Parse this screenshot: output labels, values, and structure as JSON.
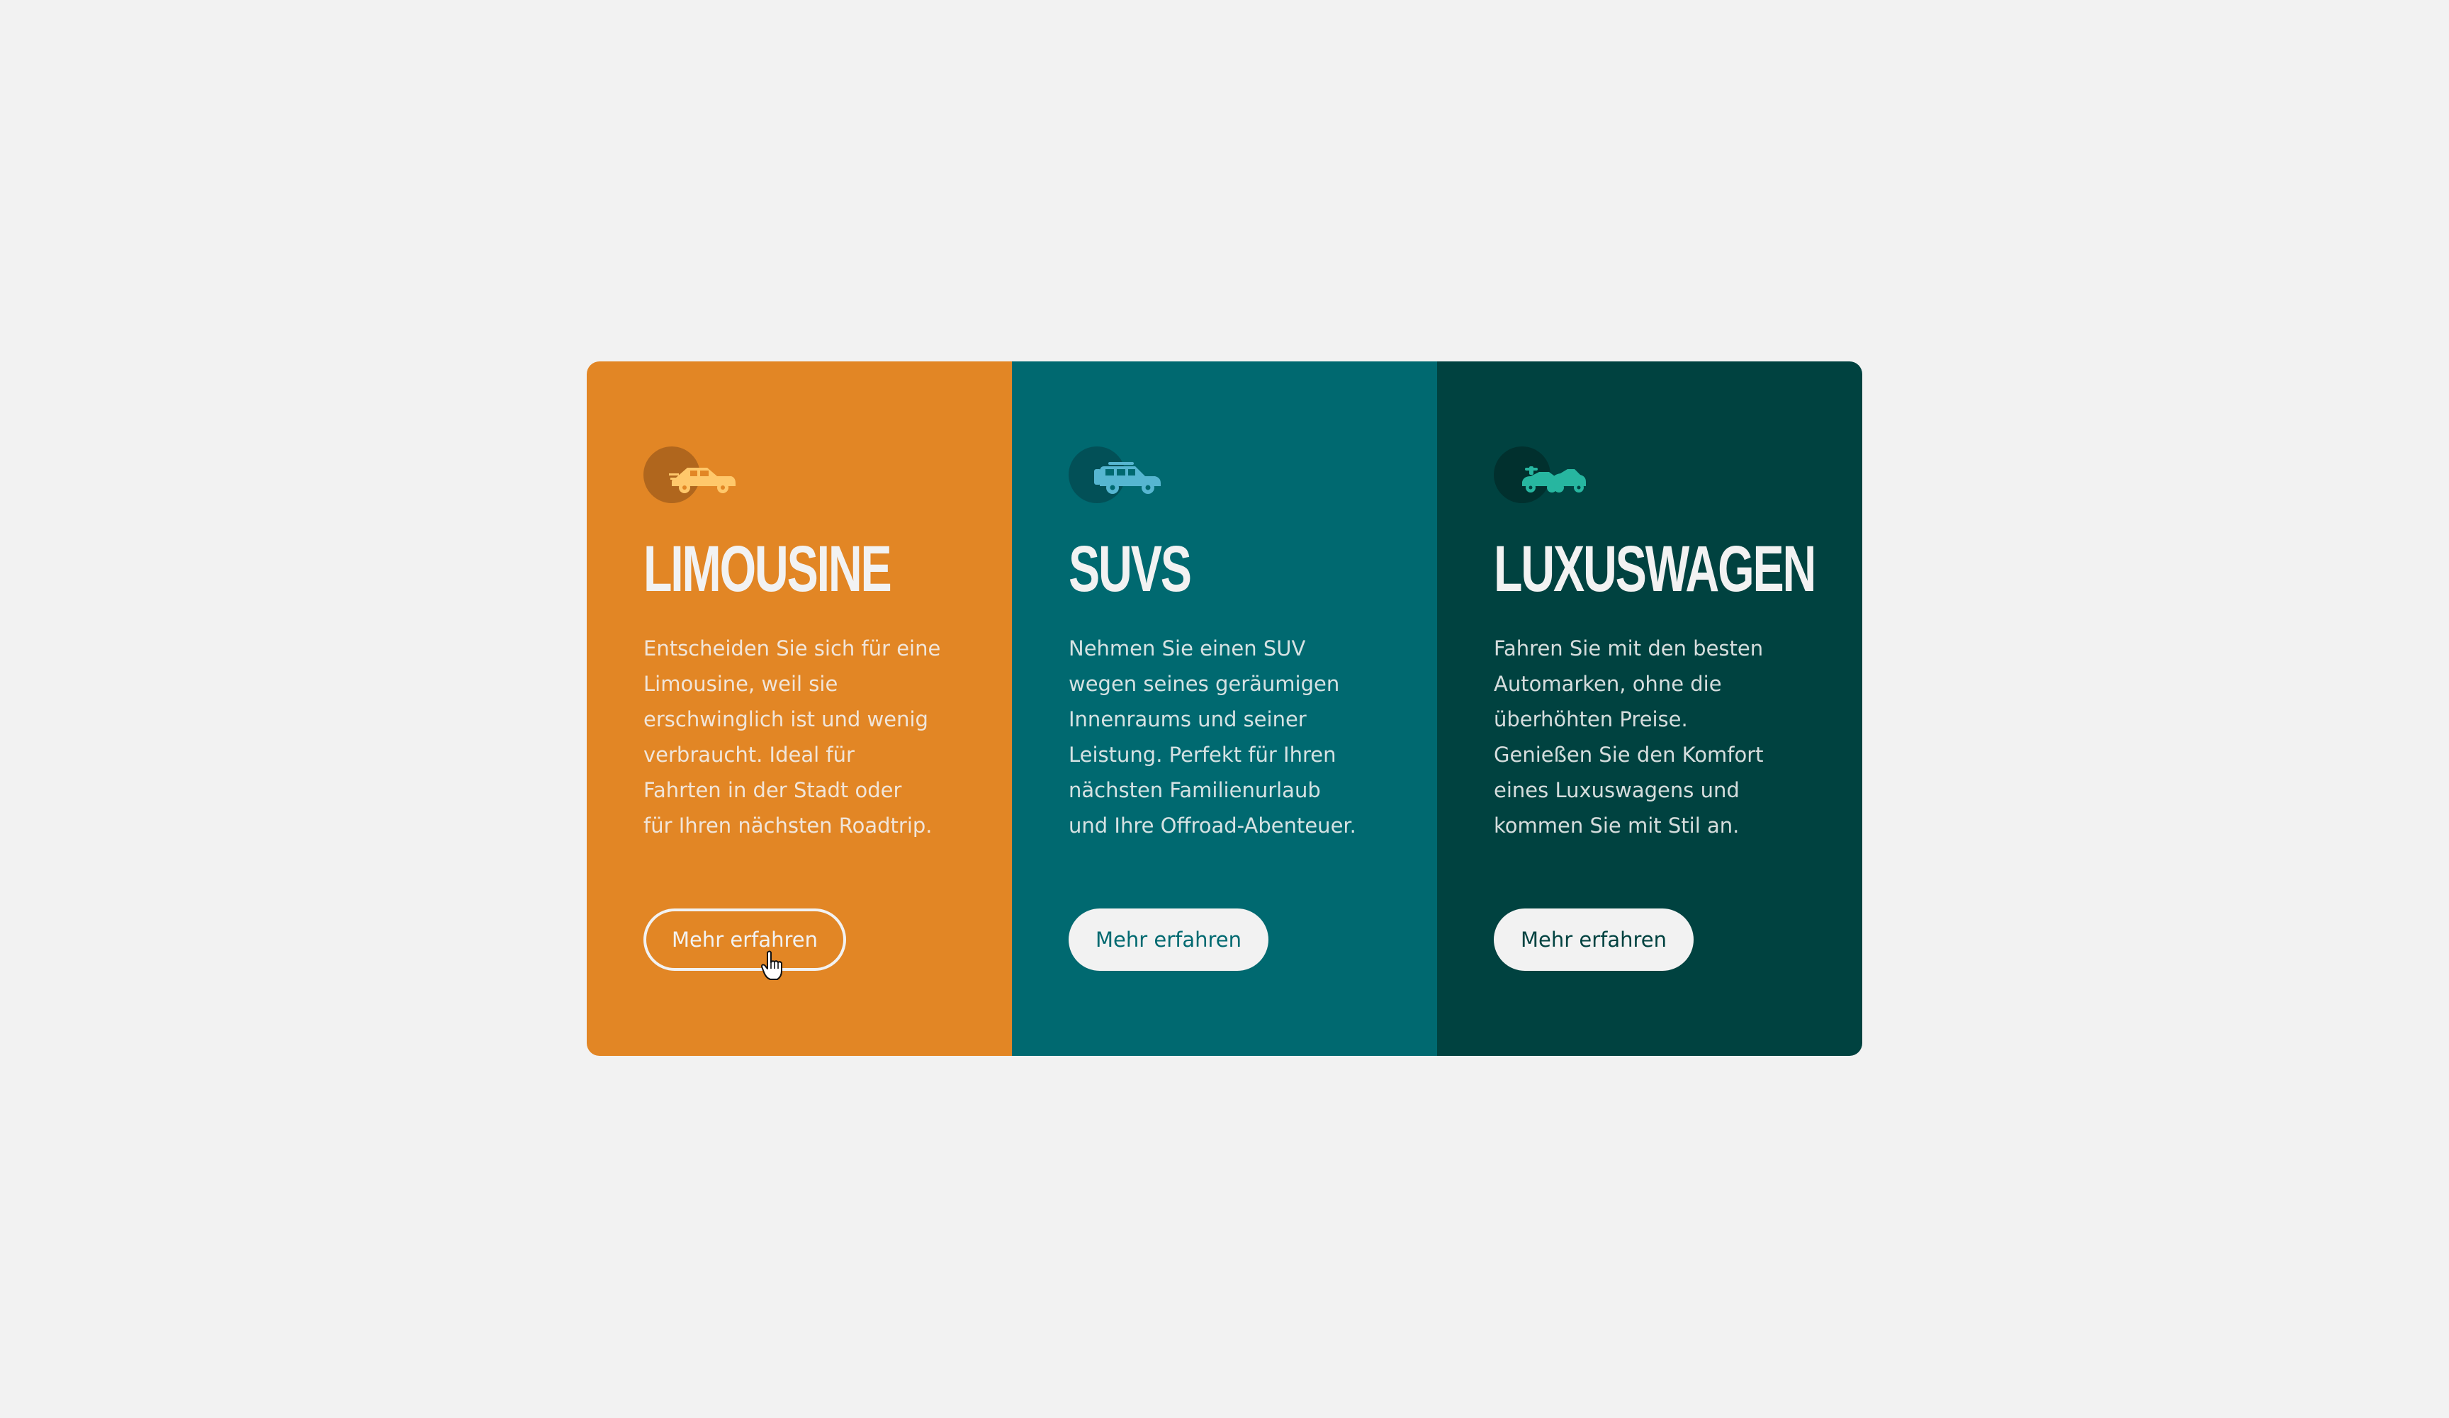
{
  "colors": {
    "page_background": "#f2f2f2",
    "sedans": "#e28625",
    "suvs": "#006970",
    "luxury": "#004240",
    "light_text": "#f2f2f2",
    "sedans_icon": "#ffc86b",
    "suvs_icon": "#56b6d1",
    "luxury_icon": "#27b6a0"
  },
  "cards": [
    {
      "icon": "sedan-car-icon",
      "title": "LIMOUSINE",
      "body_lines": [
        "Entscheiden Sie sich für eine",
        "Limousine, weil sie",
        "erschwinglich ist und wenig",
        "verbraucht. Ideal für",
        "Fahrten in der Stadt oder",
        "für Ihren nächsten Roadtrip."
      ],
      "button_label": "Mehr erfahren"
    },
    {
      "icon": "suv-car-icon",
      "title": "SUVS",
      "body_lines": [
        "Nehmen Sie einen SUV",
        "wegen seines geräumigen",
        "Innenraums und seiner",
        "Leistung. Perfekt für Ihren",
        "nächsten Familienurlaub",
        "und Ihre Offroad-Abenteuer."
      ],
      "button_label": "Mehr erfahren"
    },
    {
      "icon": "luxury-car-icon",
      "title": "LUXUSWAGEN",
      "body_lines": [
        "Fahren Sie mit den besten",
        "Automarken, ohne die",
        "überhöhten Preise.",
        "Genießen Sie den Komfort",
        "eines Luxuswagens und",
        "kommen Sie mit Stil an."
      ],
      "button_label": "Mehr erfahren"
    }
  ]
}
